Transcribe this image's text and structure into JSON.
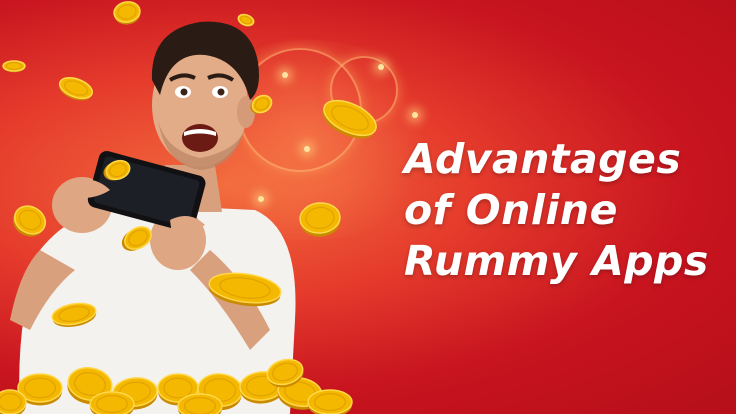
{
  "banner": {
    "headline_lines": [
      "Advantages",
      "of Online",
      "Rummy Apps"
    ]
  },
  "colors": {
    "background_dark": "#b50f1a",
    "background_light": "#f26a3c",
    "coin_gold": "#f5b800",
    "text": "#ffffff"
  },
  "icons": [
    "gold-coin",
    "smartphone",
    "excited-man"
  ]
}
